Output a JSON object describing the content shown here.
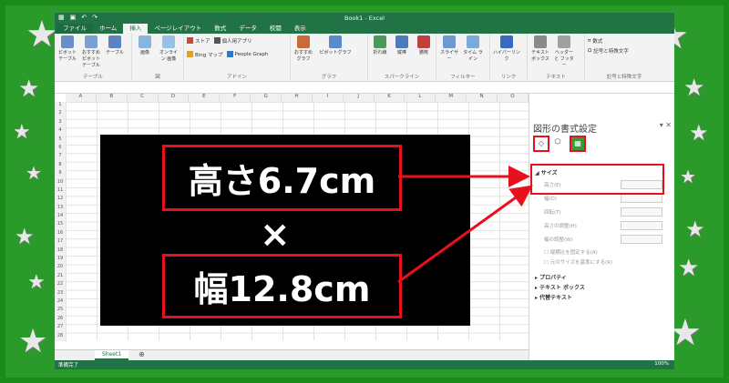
{
  "titlebar": {
    "title": "Book1 - Excel"
  },
  "tabs": [
    "ファイル",
    "ホーム",
    "挿入",
    "ページレイアウト",
    "数式",
    "データ",
    "校閲",
    "表示"
  ],
  "active_tab": "挿入",
  "ribbon": {
    "groups": [
      {
        "name": "テーブル",
        "commands": [
          "ピボット テーブル",
          "おすすめ ピボットテーブル",
          "テーブル"
        ]
      },
      {
        "name": "図",
        "commands": [
          "画像",
          "オンライン 画像"
        ]
      },
      {
        "name": "アドイン",
        "small": [
          "ストア",
          "個人用アプリ",
          "Bing マップ",
          "People Graph"
        ]
      },
      {
        "name": "グラフ",
        "commands": [
          "おすすめ グラフ",
          "ピボットグラフ"
        ]
      },
      {
        "name": "スパークライン",
        "commands": [
          "折れ線",
          "縦棒",
          "勝敗"
        ]
      },
      {
        "name": "フィルター",
        "commands": [
          "スライサー",
          "タイム ライン"
        ]
      },
      {
        "name": "リンク",
        "commands": [
          "ハイパーリンク"
        ]
      },
      {
        "name": "テキスト",
        "commands": [
          "テキスト ボックス",
          "ヘッダーと フッター"
        ]
      },
      {
        "name": "記号と特殊文字",
        "small": [
          "数式",
          "記号と特殊文字"
        ]
      }
    ]
  },
  "columns": [
    "A",
    "B",
    "C",
    "D",
    "E",
    "F",
    "G",
    "H",
    "I",
    "J",
    "K",
    "L",
    "M",
    "N",
    "O"
  ],
  "rows": [
    "1",
    "2",
    "3",
    "4",
    "5",
    "6",
    "7",
    "8",
    "9",
    "10",
    "11",
    "12",
    "13",
    "14",
    "15",
    "16",
    "17",
    "18",
    "19",
    "20",
    "21",
    "22",
    "23",
    "24",
    "25",
    "26",
    "27",
    "28"
  ],
  "shape": {
    "height_label": "高さ6.7cm",
    "times": "×",
    "width_label": "幅12.8cm"
  },
  "sheet_tab": "Sheet1",
  "status": {
    "ready": "準備完了",
    "zoom": "100%"
  },
  "pane": {
    "title": "図形の書式設定",
    "sections": {
      "size": "サイズ",
      "properties": "プロパティ",
      "textbox": "テキスト ボックス",
      "alt_text": "代替テキスト"
    },
    "fields": [
      "高さ(E)",
      "幅(D)",
      "回転(T)",
      "高さの調整(H)",
      "幅の調整(W)",
      "縦横比を固定する(A)",
      "元のサイズを基準にする(R)"
    ]
  },
  "colors": {
    "excel_green": "#217346",
    "highlight_red": "#e8101c",
    "frame_green": "#1a8a1a"
  }
}
